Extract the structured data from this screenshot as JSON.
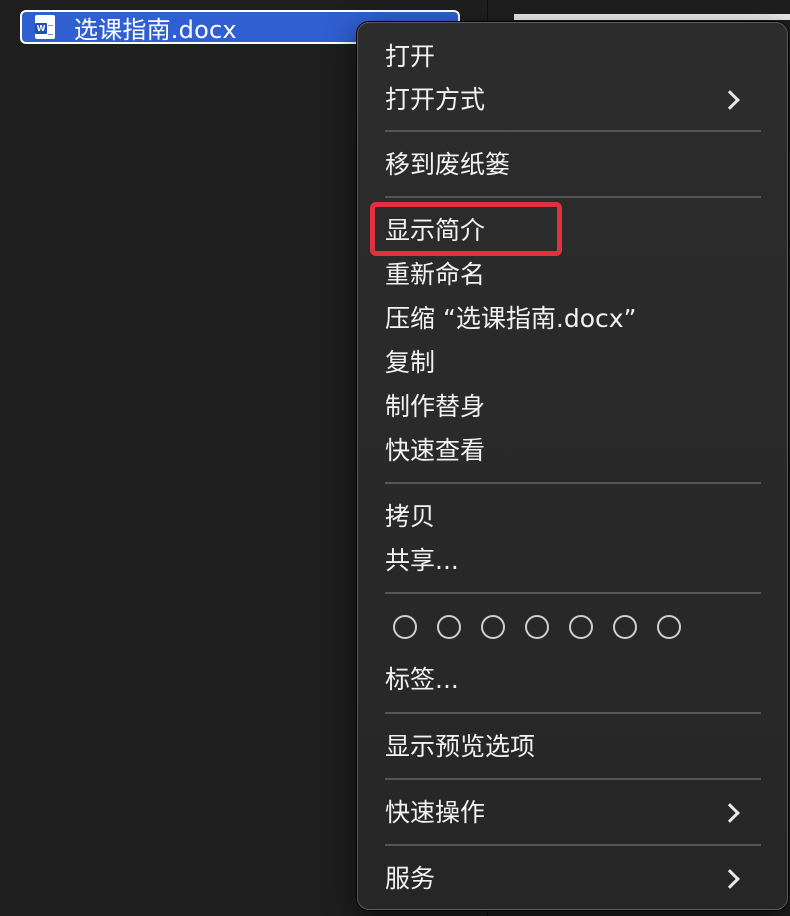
{
  "file": {
    "name": "选课指南.docx",
    "icon": "word-document-icon"
  },
  "menu": {
    "open": "打开",
    "open_with": "打开方式",
    "move_to_trash": "移到废纸篓",
    "get_info": "显示简介",
    "rename": "重新命名",
    "compress": "压缩 “选课指南.docx”",
    "duplicate": "复制",
    "make_alias": "制作替身",
    "quick_look": "快速查看",
    "copy": "拷贝",
    "share": "共享...",
    "tags": "标签...",
    "show_view_options": "显示预览选项",
    "quick_actions": "快速操作",
    "services": "服务"
  },
  "colors": {
    "selection_blue": "#2f5fd0",
    "highlight_red": "#e0323c",
    "menu_bg": "#2a2a2a"
  }
}
